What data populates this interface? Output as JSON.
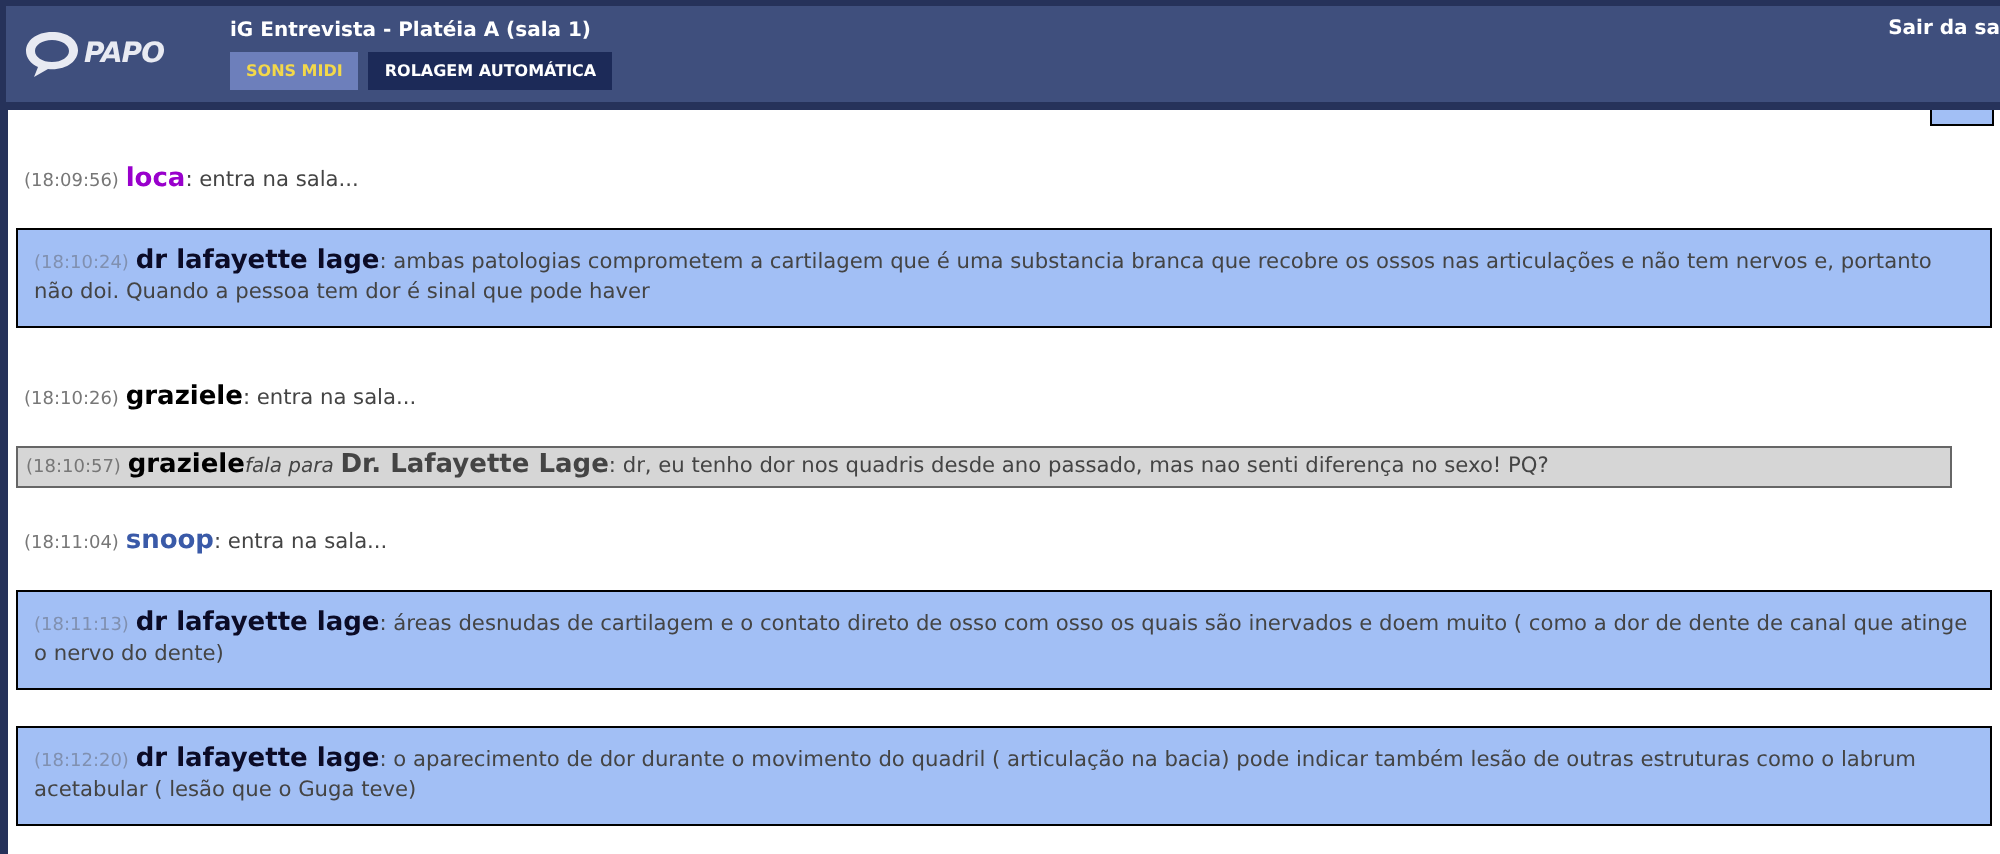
{
  "header": {
    "logo": "PAPO",
    "title": "iG Entrevista - Platéia A (sala 1)",
    "exit_link": "Sair da sa",
    "buttons": [
      {
        "label": "SONS MIDI",
        "selected": true
      },
      {
        "label": "ROLAGEM AUTOMÁTICA",
        "selected": false
      }
    ]
  },
  "messages": [
    {
      "kind": "join",
      "time": "(18:09:56)",
      "user": "loca",
      "color": "#9900cc",
      "text": ": entra na sala..."
    },
    {
      "kind": "highlight",
      "time": "(18:10:24)",
      "user": "dr lafayette lage",
      "color": "#0b0b26",
      "text": ": ambas patologias comprometem a cartilagem que é uma substancia branca que recobre os ossos nas articulações e não tem nervos e, portanto não doi. Quando a pessoa tem dor é sinal que pode haver"
    },
    {
      "kind": "join",
      "time": "(18:10:26)",
      "user": "graziele",
      "color": "#000000",
      "text": ": entra na sala..."
    },
    {
      "kind": "private",
      "time": "(18:10:57)",
      "user": "graziele",
      "color": "#000000",
      "verb": "fala para",
      "recipient": "Dr. Lafayette Lage",
      "text": ": dr, eu tenho dor nos quadris desde ano passado, mas nao senti diferença no sexo! PQ?"
    },
    {
      "kind": "join",
      "time": "(18:11:04)",
      "user": "snoop",
      "color": "#3a5aa8",
      "text": ": entra na sala..."
    },
    {
      "kind": "highlight",
      "time": "(18:11:13)",
      "user": "dr lafayette lage",
      "color": "#0b0b26",
      "text": ": áreas desnudas de cartilagem e o contato direto de osso com osso os quais são inervados e doem muito ( como a dor de dente de canal que atinge o nervo do dente)"
    },
    {
      "kind": "highlight",
      "time": "(18:12:20)",
      "user": "dr lafayette lage",
      "color": "#0b0b26",
      "text": ": o aparecimento de dor durante o movimento do quadril ( articulação na bacia) pode indicar também lesão de outras estruturas como o labrum acetabular ( lesão que o Guga teve)"
    }
  ]
}
